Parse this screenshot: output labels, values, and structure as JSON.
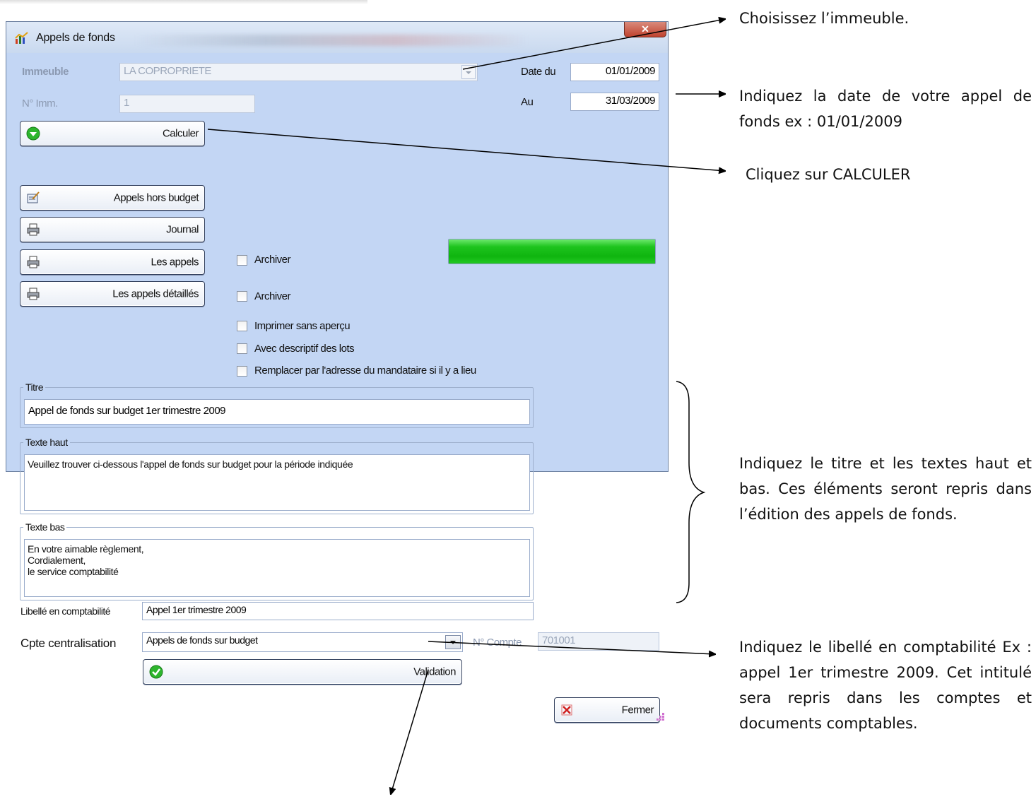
{
  "window": {
    "title": "Appels de fonds",
    "close_glyph": "✕"
  },
  "form": {
    "immeuble_label": "Immeuble",
    "immeuble_value": "LA COPROPRIETE",
    "num_imm_label": "N° Imm.",
    "num_imm_value": "1",
    "date_du_label": "Date du",
    "date_du_value": "01/01/2009",
    "au_label": "Au",
    "au_value": "31/03/2009",
    "libelle_label": "Libellé en comptabilité",
    "libelle_value": "Appel 1er trimestre 2009",
    "cpte_label": "Cpte centralisation",
    "cpte_value": "Appels de fonds sur budget",
    "num_compte_label": "N° Compte",
    "num_compte_value": "701001"
  },
  "buttons": {
    "calculer": "Calculer",
    "appels_hors_budget": "Appels hors budget",
    "journal": "Journal",
    "les_appels": "Les appels",
    "les_appels_detailles": "Les appels détaillés",
    "validation": "Validation",
    "fermer": "Fermer"
  },
  "checkboxes": {
    "archiver_1": "Archiver",
    "archiver_2": "Archiver",
    "imprimer_sans_apercu": "Imprimer sans aperçu",
    "avec_descriptif": "Avec descriptif des lots",
    "remplacer_adresse": "Remplacer par l'adresse du mandataire si il y a lieu"
  },
  "progress": {
    "value": 1.0,
    "color": "#19c019"
  },
  "titre": {
    "legend": "Titre",
    "value": "Appel de fonds sur budget 1er trimestre 2009"
  },
  "texte_haut": {
    "legend": "Texte haut",
    "value": "Veuillez trouver ci-dessous l'appel de fonds sur budget pour la période indiquée"
  },
  "texte_bas": {
    "legend": "Texte bas",
    "value": "En votre aimable règlement,\nCordialement,\nle service comptabilité"
  },
  "annotations": {
    "immeuble": "Choisissez l’immeuble.",
    "date": "Indiquez la date de votre appel de fonds ex : 01/01/2009",
    "calculer": "Cliquez sur CALCULER",
    "textes": "Indiquez le titre et les textes haut et bas. Ces éléments seront repris dans l’édition des appels de fonds.",
    "libelle": "Indiquez le libellé en comptabilité Ex : appel 1er trimestre 2009. Cet intitulé sera repris dans les comptes et documents comptables."
  },
  "icons": {
    "app": "chart-icon",
    "calculer": "green-arrow-down-icon",
    "appels_hors_budget": "edit-form-icon",
    "print": "printer-icon",
    "validation": "green-check-icon",
    "fermer": "red-x-icon"
  }
}
